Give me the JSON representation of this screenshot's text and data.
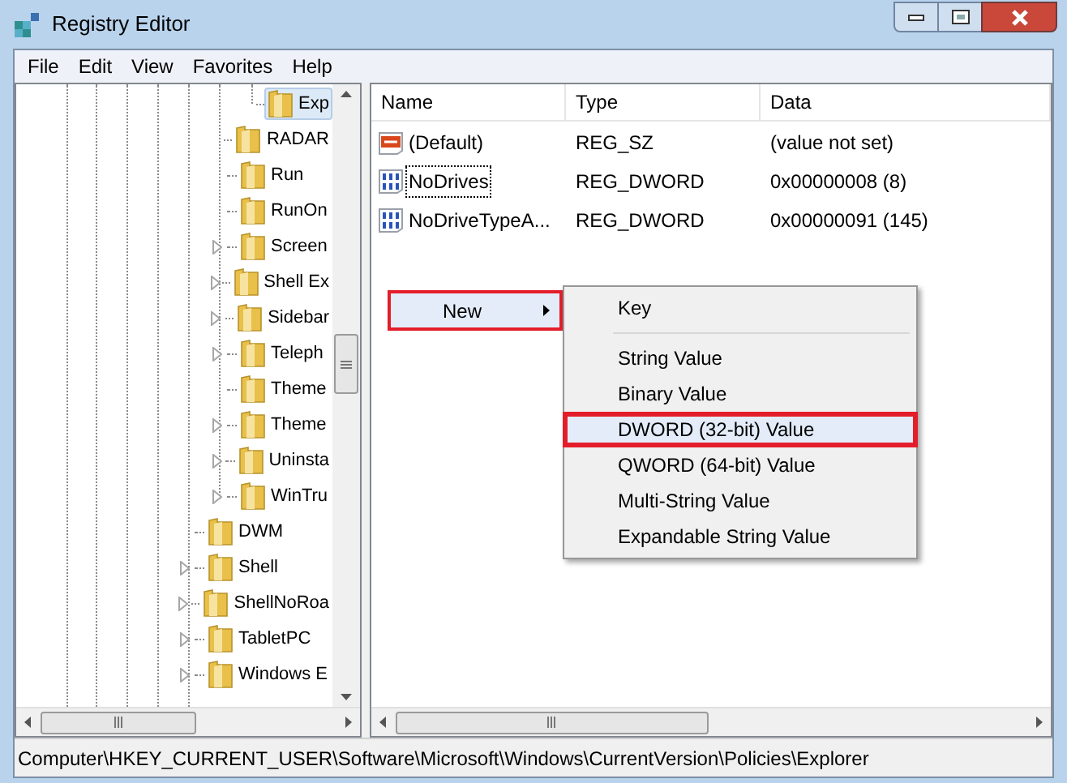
{
  "window": {
    "title": "Registry Editor"
  },
  "menu_bar": [
    "File",
    "Edit",
    "View",
    "Favorites",
    "Help"
  ],
  "tree": {
    "items": [
      {
        "children": [
          {
            "children": [
              {
                "label": "Exp",
                "expandable": false,
                "selected": true
              }
            ]
          },
          {
            "label": "RADAR",
            "expandable": false,
            "selected": false
          },
          {
            "label": "Run",
            "expandable": false,
            "selected": false
          },
          {
            "label": "RunOn",
            "expandable": false,
            "selected": false
          },
          {
            "label": "Screen",
            "expandable": true,
            "selected": false
          },
          {
            "label": "Shell Ex",
            "expandable": true,
            "selected": false
          },
          {
            "label": "Sidebar",
            "expandable": true,
            "selected": false
          },
          {
            "label": "Teleph",
            "expandable": true,
            "selected": false
          },
          {
            "label": "Theme",
            "expandable": false,
            "selected": false
          },
          {
            "label": "Theme",
            "expandable": true,
            "selected": false
          },
          {
            "label": "Uninsta",
            "expandable": true,
            "selected": false
          },
          {
            "label": "WinTru",
            "expandable": true,
            "selected": false
          }
        ]
      },
      {
        "label": "DWM",
        "expandable": false,
        "selected": false
      },
      {
        "label": "Shell",
        "expandable": true,
        "selected": false
      },
      {
        "label": "ShellNoRoa",
        "expandable": true,
        "selected": false
      },
      {
        "label": "TabletPC",
        "expandable": true,
        "selected": false
      },
      {
        "label": "Windows E",
        "expandable": true,
        "selected": false
      }
    ]
  },
  "values": {
    "columns": [
      "Name",
      "Type",
      "Data"
    ],
    "rows": [
      {
        "kind": "string",
        "name": "(Default)",
        "type": "REG_SZ",
        "data": "(value not set)",
        "focused": false
      },
      {
        "kind": "binary",
        "name": "NoDrives",
        "type": "REG_DWORD",
        "data": "0x00000008 (8)",
        "focused": true
      },
      {
        "kind": "binary",
        "name": "NoDriveTypeA...",
        "type": "REG_DWORD",
        "data": "0x00000091 (145)",
        "focused": false
      }
    ]
  },
  "context_menu": {
    "item": {
      "label": "New",
      "selected": true,
      "outlined": true
    },
    "submenu": [
      {
        "kind": "item",
        "label": "Key",
        "selected": false,
        "outlined": false
      },
      {
        "kind": "separator"
      },
      {
        "kind": "item",
        "label": "String Value",
        "selected": false,
        "outlined": false
      },
      {
        "kind": "item",
        "label": "Binary Value",
        "selected": false,
        "outlined": false
      },
      {
        "kind": "item",
        "label": "DWORD (32-bit) Value",
        "selected": true,
        "outlined": true
      },
      {
        "kind": "item",
        "label": "QWORD (64-bit) Value",
        "selected": false,
        "outlined": false
      },
      {
        "kind": "item",
        "label": "Multi-String Value",
        "selected": false,
        "outlined": false
      },
      {
        "kind": "item",
        "label": "Expandable String Value",
        "selected": false,
        "outlined": false
      }
    ]
  },
  "status_bar": "Computer\\HKEY_CURRENT_USER\\Software\\Microsoft\\Windows\\CurrentVersion\\Policies\\Explorer"
}
